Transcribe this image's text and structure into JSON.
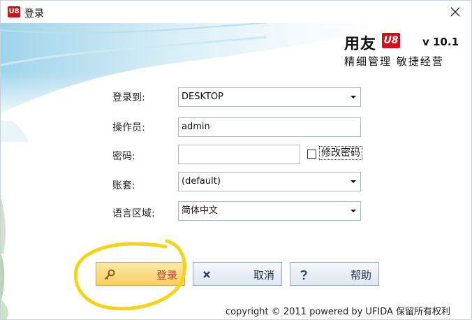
{
  "window": {
    "title": "登录",
    "app_icon_text": "U8"
  },
  "brand": {
    "name": "用友",
    "logo_text": "U8",
    "version": "v 10.1",
    "slogan": "精细管理 敏捷经营"
  },
  "form": {
    "login_to_label": "登录到:",
    "login_to_value": "DESKTOP",
    "operator_label": "操作员:",
    "operator_value": "admin",
    "password_label": "密码:",
    "password_value": "",
    "change_password_label": "修改密码",
    "change_password_checked": false,
    "account_set_label": "账套:",
    "account_set_value": "(default)",
    "language_label": "语言区域:",
    "language_value": "简体中文"
  },
  "buttons": {
    "login": "登录",
    "cancel": "取消",
    "help": "帮助"
  },
  "footer": {
    "copyright": "copyright © 2011 powered by UFIDA 保留所有权利"
  },
  "colors": {
    "brand_red": "#d0101a",
    "login_button": "#f8cf5e",
    "highlight_ring": "#f5d31a"
  },
  "icons": {
    "login": "key-icon",
    "cancel": "x-icon",
    "help": "question-icon"
  }
}
